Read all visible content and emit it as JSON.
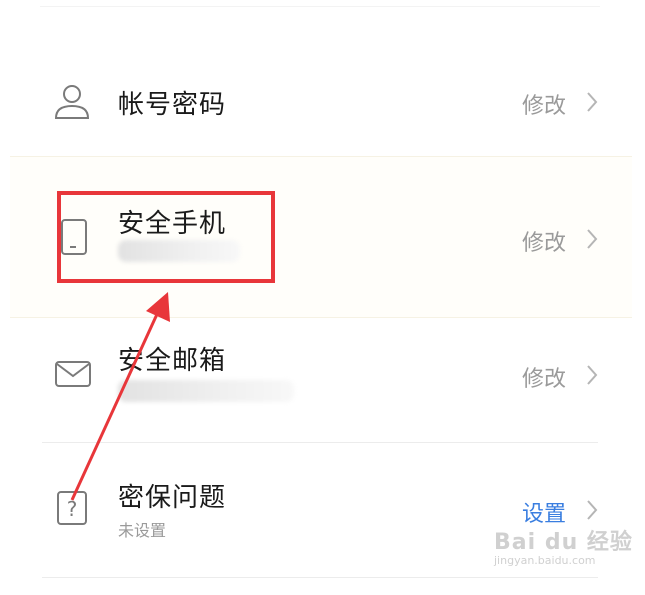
{
  "rows": [
    {
      "title": "帐号密码",
      "action": "修改",
      "icon": "user-icon"
    },
    {
      "title": "安全手机",
      "action": "修改",
      "icon": "phone-icon"
    },
    {
      "title": "安全邮箱",
      "action": "修改",
      "icon": "mail-icon"
    },
    {
      "title": "密保问题",
      "subtitle": "未设置",
      "action": "设置",
      "icon": "question-icon"
    }
  ],
  "watermark": {
    "main": "Bai du 经验",
    "sub": "jingyan.baidu.com"
  },
  "colors": {
    "highlight_box": "#e8363a",
    "arrow": "#e8363a",
    "link_blue": "#3a7ee0",
    "muted": "#9a9a9a"
  }
}
